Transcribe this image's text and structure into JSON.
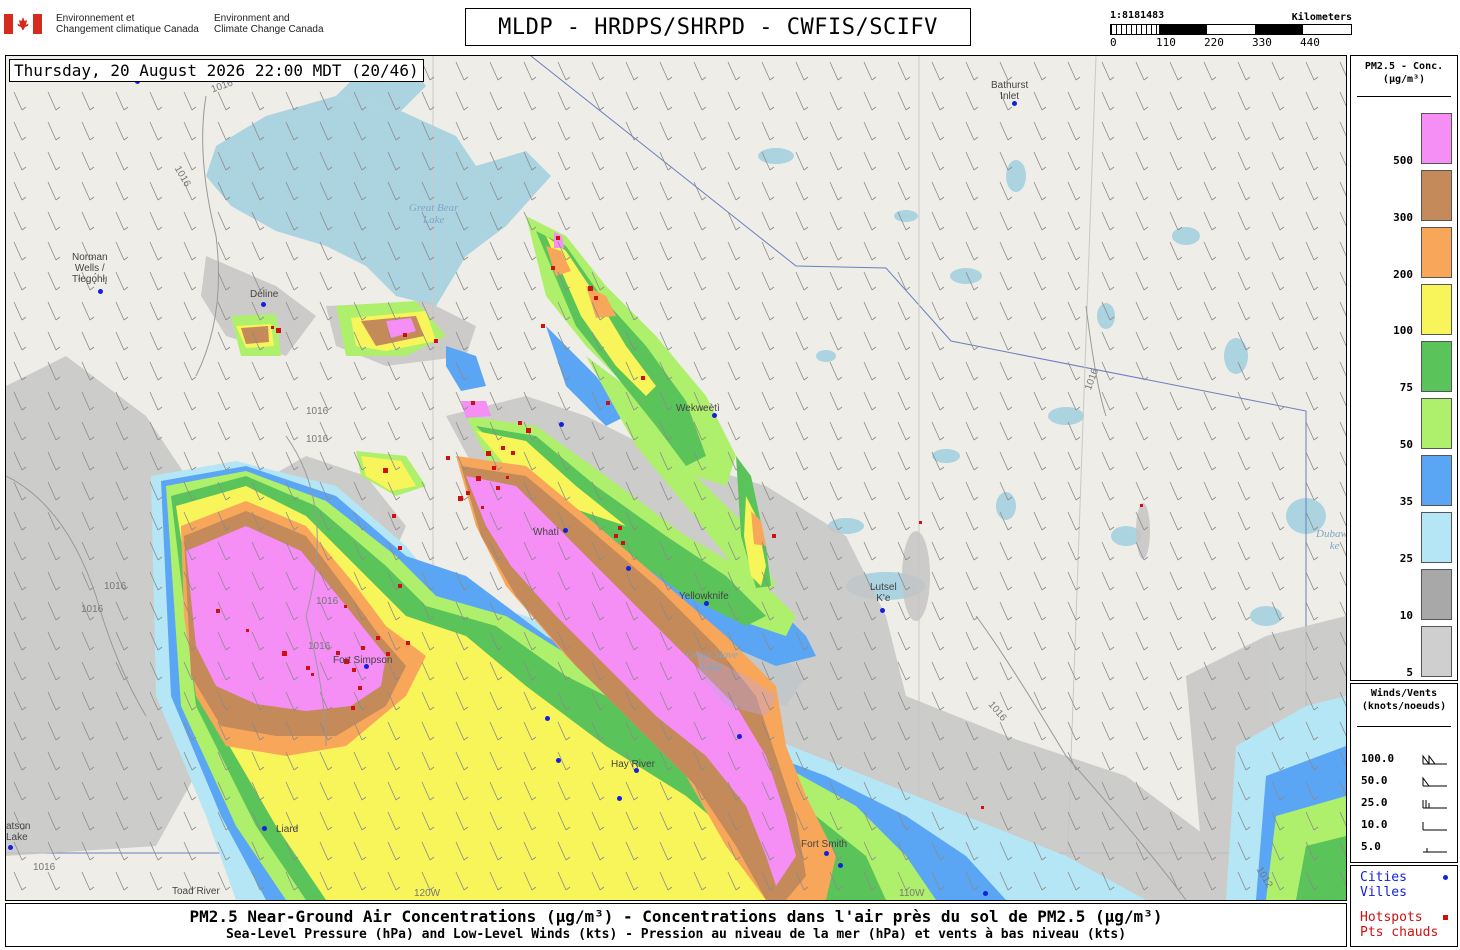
{
  "header": {
    "agency_fr_line1": "Environnement et",
    "agency_fr_line2": "Changement climatique Canada",
    "agency_en_line1": "Environment and",
    "agency_en_line2": "Climate Change Canada",
    "title": "MLDP - HRDPS/SHRPD - CWFIS/SCIFV"
  },
  "scale": {
    "ratio": "1:8181483",
    "unit": "Kilometers",
    "ticks": [
      "0",
      "110",
      "220",
      "330",
      "440"
    ]
  },
  "map": {
    "date_label": "Thursday, 20 August 2026 22:00 MDT (20/46)",
    "places": [
      {
        "name": "Norman Wells / Tłegóhłį",
        "line1": "Norman",
        "line2": "Wells /",
        "line3": "Tłegǫ́hłı̨"
      },
      {
        "name": "Délı̨nę",
        "line1": "Déline"
      },
      {
        "name": "Bathurst Inlet",
        "line1": "Bathurst",
        "line2": "Inlet"
      },
      {
        "name": "Wekweètì",
        "line1": "Wekweètì"
      },
      {
        "name": "Whatì",
        "line1": "Whatì"
      },
      {
        "name": "Yellowknife",
        "line1": "Yellowknife"
      },
      {
        "name": "Łutsël K'e",
        "line1": "Lutsel",
        "line2": "K'e"
      },
      {
        "name": "Fort Simpson",
        "line1": "Fort Simpson"
      },
      {
        "name": "Hay River",
        "line1": "Hay River"
      },
      {
        "name": "Fort Smith",
        "line1": "Fort Smith"
      },
      {
        "name": "Toad River",
        "line1": "Toad River"
      },
      {
        "name": "Watson Lake",
        "line1": "atson",
        "line2": "Lake"
      },
      {
        "name": "Fort Liard",
        "line1": "Liard"
      }
    ],
    "lakes": [
      {
        "name": "Great Bear Lake",
        "line1": "Great Bear",
        "line2": "Lake"
      },
      {
        "name": "Great Slave Lake",
        "line1": "Great Slave",
        "line2": "Lake"
      },
      {
        "name": "Dubawnt Lake",
        "line1": "Dubawn",
        "line2": "ke"
      }
    ],
    "isobar_value": "1016",
    "isobar_alt": "1012",
    "meridians": [
      "120W",
      "110W"
    ]
  },
  "legend": {
    "title_line1": "PM2.5 - Conc.",
    "title_line2": "(µg/m³)",
    "levels": [
      {
        "label": "500",
        "color": "#f58ef5"
      },
      {
        "label": "300",
        "color": "#c48a5a"
      },
      {
        "label": "200",
        "color": "#f7a65a"
      },
      {
        "label": "100",
        "color": "#f7f55a"
      },
      {
        "label": "75",
        "color": "#5ac45a"
      },
      {
        "label": "50",
        "color": "#aef06b"
      },
      {
        "label": "35",
        "color": "#5aa6f5"
      },
      {
        "label": "25",
        "color": "#b4e6f5"
      },
      {
        "label": "10",
        "color": "#a8a8a8"
      },
      {
        "label": "5",
        "color": "#cfcfcf"
      }
    ]
  },
  "winds": {
    "title_line1": "Winds/Vents",
    "title_line2": "(knots/noeuds)",
    "rows": [
      "100.0",
      "50.0",
      "25.0",
      "10.0",
      "5.0"
    ]
  },
  "cities_legend": {
    "cities_en": "Cities",
    "cities_fr": "Villes",
    "hotspots_en": "Hotspots",
    "hotspots_fr": "Pts chauds",
    "city_color": "#1420e0",
    "hotspot_color": "#d01010"
  },
  "footer": {
    "line1": "PM2.5 Near-Ground Air Concentrations (µg/m³) - Concentrations dans l'air près du sol de PM2.5 (µg/m³)",
    "line2": "Sea-Level Pressure (hPa) and Low-Level Winds (kts) - Pression au niveau de la mer (hPa) et vents à bas niveau (kts)"
  }
}
